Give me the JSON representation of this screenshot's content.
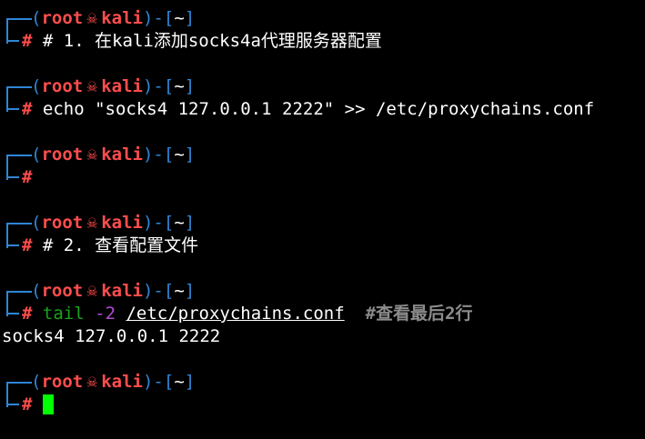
{
  "prompt": {
    "open": "(",
    "user": "root",
    "skull": "☠",
    "host": "kali",
    "close": ")-[",
    "dir": "~",
    "end": "]",
    "hash": "#"
  },
  "blocks": [
    {
      "command": "# 1. 在kali添加socks4a代理服务器配置"
    },
    {
      "command": "echo \"socks4 127.0.0.1 2222\" >> /etc/proxychains.conf"
    },
    {
      "command": ""
    },
    {
      "command": "# 2. 查看配置文件"
    },
    {
      "cmd_name": "tail",
      "cmd_flag": "-2",
      "cmd_path": "/etc/proxychains.conf",
      "cmd_comment": "#查看最后2行",
      "output": "socks4 127.0.0.1 2222"
    },
    {
      "command": ""
    }
  ],
  "colors": {
    "background": "#000000",
    "prompt_line": "#2f86d6",
    "prompt_user": "#ff4d4d",
    "command_name": "#1aa31a",
    "flag": "#b04bd8",
    "comment": "#8c8c8c",
    "cursor": "#00ff00"
  },
  "icons": {
    "skull": "skull-icon",
    "cursor": "block-cursor"
  }
}
